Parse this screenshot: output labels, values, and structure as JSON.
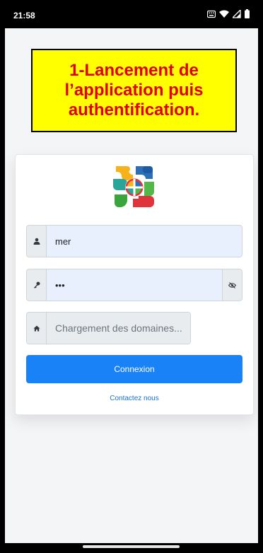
{
  "status_bar": {
    "time": "21:58",
    "icons": [
      "keyboard-icon",
      "wifi-icon",
      "signal-icon",
      "battery-icon"
    ]
  },
  "annotation": {
    "text": "1-Lancement de\nl’application puis\nauthentification.",
    "background": "#ffff00",
    "text_color": "#e0001b"
  },
  "login": {
    "username_value": "mer",
    "password_value": "•••",
    "domain_placeholder": "Chargement des domaines...",
    "submit_label": "Connexion",
    "contact_label": "Contactez nous"
  },
  "colors": {
    "primary": "#1a82f7",
    "link": "#1a6ed8",
    "autofill": "#e8f0fe"
  }
}
